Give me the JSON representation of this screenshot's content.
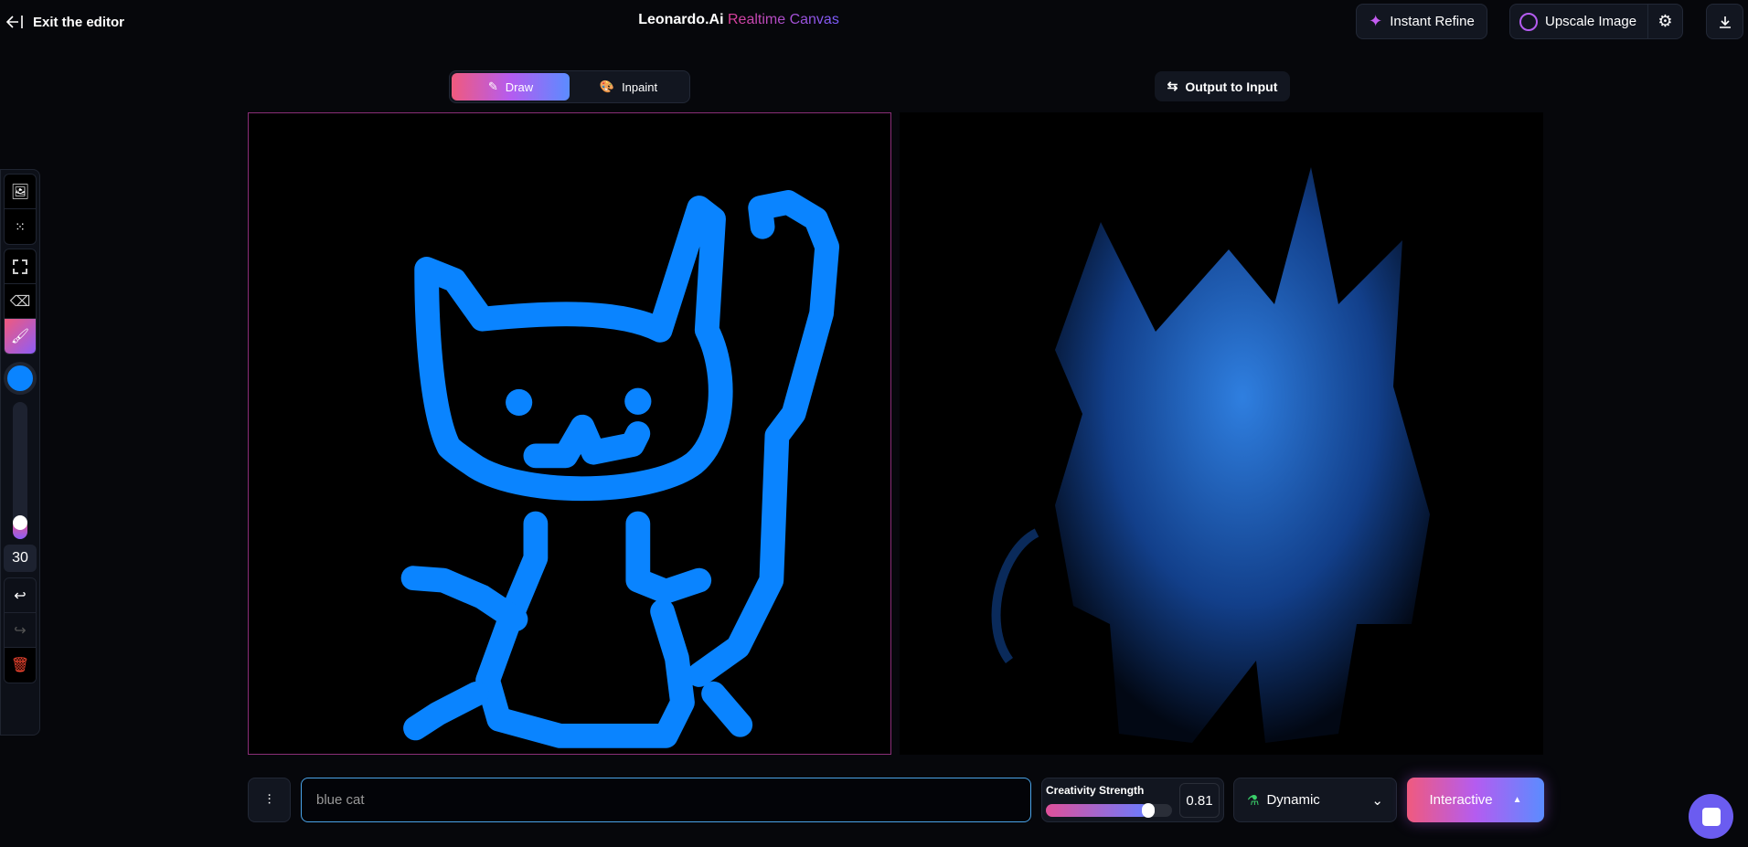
{
  "header": {
    "exit_label": "Exit the editor",
    "brand": "Leonardo.Ai",
    "brand_sub": "Realtime Canvas",
    "instant_refine": "Instant Refine",
    "upscale": "Upscale Image"
  },
  "mode": {
    "draw": "Draw",
    "inpaint": "Inpaint",
    "active": "Draw"
  },
  "output_to_input": "Output to Input",
  "tools": {
    "brush_color": "#0a84ff",
    "brush_size": "30",
    "brush_size_fraction": 0.05
  },
  "prompt": {
    "value": "blue cat"
  },
  "creativity": {
    "label": "Creativity Strength",
    "value": "0.81",
    "fraction": 0.81
  },
  "style": {
    "selected": "Dynamic"
  },
  "generate": {
    "label": "Interactive"
  },
  "colors": {
    "accent_pink": "#f05a7e",
    "accent_purple": "#b45cf0",
    "accent_blue": "#5b8cff",
    "drawing": "#0a84ff"
  }
}
